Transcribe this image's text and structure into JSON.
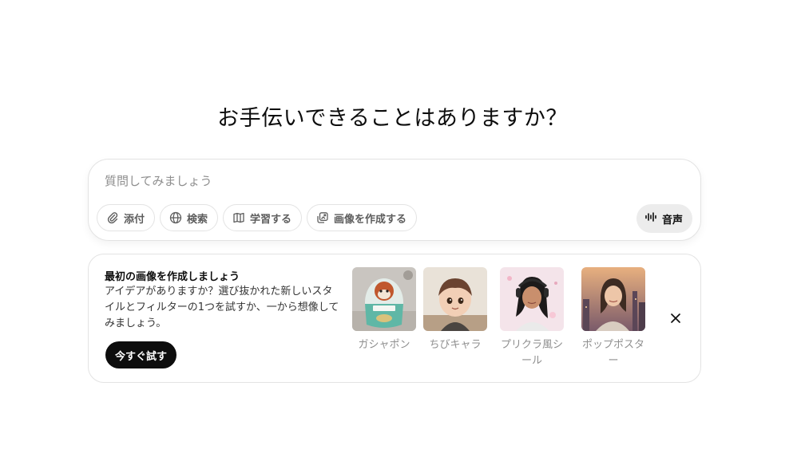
{
  "headline": "お手伝いできることはありますか？",
  "composer": {
    "placeholder": "質問してみましょう",
    "tools": [
      {
        "label": "添付",
        "icon": "paperclip-icon"
      },
      {
        "label": "検索",
        "icon": "globe-icon"
      },
      {
        "label": "学習する",
        "icon": "book-icon"
      },
      {
        "label": "画像を作成する",
        "icon": "image-stack-icon"
      }
    ],
    "voice_label": "音声",
    "voice_icon": "waveform-icon"
  },
  "card": {
    "title": "最初の画像を作成しましょう",
    "description": "アイデアがありますか？選び抜かれた新しいスタイルとフィルターの1つを試すか、一から想像してみましょう。",
    "button_label": "今すぐ試す",
    "styles": [
      {
        "label": "ガシャポン"
      },
      {
        "label": "ちびキャラ"
      },
      {
        "label": "プリクラ風シール"
      },
      {
        "label": "ポップポスター"
      }
    ],
    "close_icon": "close-icon"
  },
  "colors": {
    "text": "#0d0d0d",
    "muted": "#8f8f8f",
    "border": "#e3e3e3",
    "button_bg": "#0d0d0d",
    "voice_bg": "#ececec"
  }
}
